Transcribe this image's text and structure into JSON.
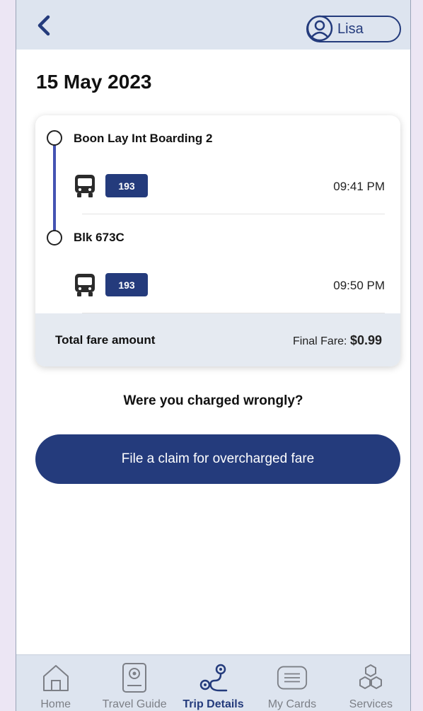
{
  "header": {
    "user_name": "Lisa"
  },
  "trip": {
    "date": "15 May 2023",
    "stops": [
      {
        "name": "Boon Lay Int Boarding 2",
        "route": "193",
        "time": "09:41 PM"
      },
      {
        "name": "Blk 673C",
        "route": "193",
        "time": "09:50 PM"
      }
    ],
    "fare_label": "Total fare amount",
    "final_fare_prefix": "Final Fare: ",
    "final_fare_amount": "$0.99"
  },
  "claim": {
    "question": "Were you charged wrongly?",
    "button_label": "File a claim for overcharged fare"
  },
  "nav": {
    "items": [
      {
        "label": "Home",
        "icon": "home-icon"
      },
      {
        "label": "Travel Guide",
        "icon": "travel-guide-icon"
      },
      {
        "label": "Trip Details",
        "icon": "trip-details-icon",
        "active": true
      },
      {
        "label": "My Cards",
        "icon": "cards-icon"
      },
      {
        "label": "Services",
        "icon": "services-icon"
      }
    ]
  },
  "colors": {
    "brand": "#243b7c",
    "timeline": "#4453b2",
    "header_bg": "#dde4ef",
    "fare_bar_bg": "#e5eaf1",
    "page_bg": "#ece6f4"
  }
}
